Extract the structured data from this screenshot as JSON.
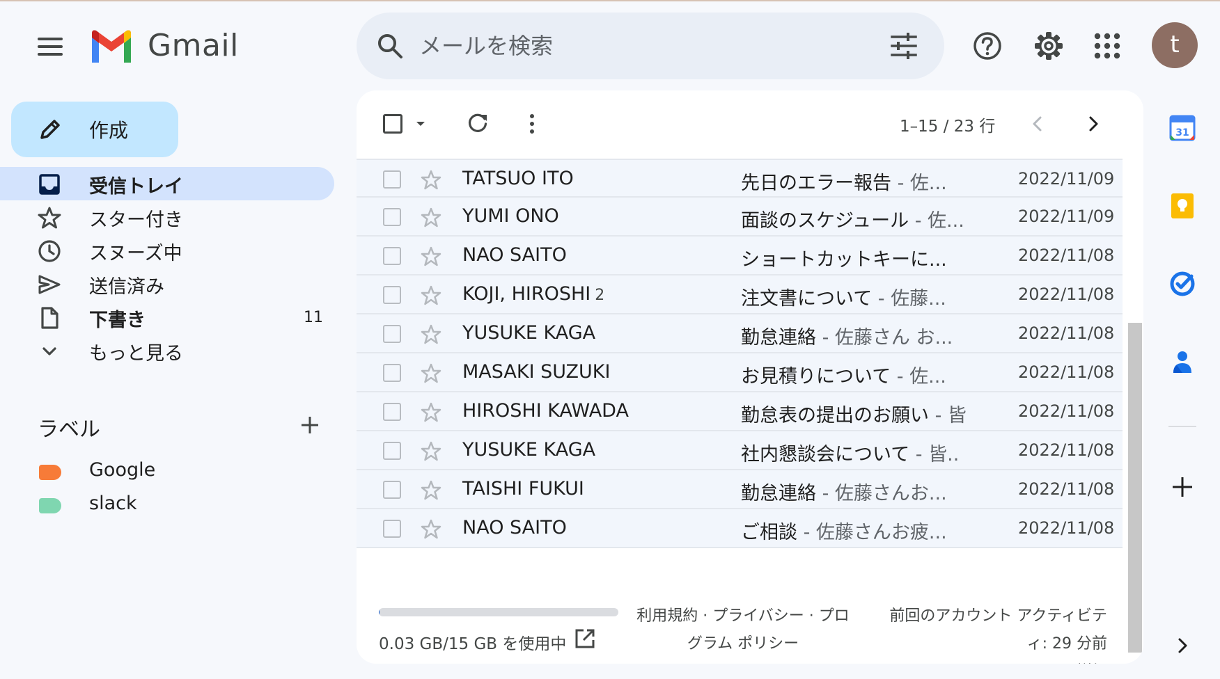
{
  "app": {
    "name": "Gmail"
  },
  "search": {
    "placeholder": "メールを検索"
  },
  "user": {
    "initial": "t"
  },
  "compose": {
    "label": "作成"
  },
  "nav": [
    {
      "label": "受信トレイ",
      "icon": "inbox-icon",
      "active": true,
      "bold": true,
      "count": ""
    },
    {
      "label": "スター付き",
      "icon": "star-icon",
      "active": false,
      "bold": false,
      "count": ""
    },
    {
      "label": "スヌーズ中",
      "icon": "clock-icon",
      "active": false,
      "bold": false,
      "count": ""
    },
    {
      "label": "送信済み",
      "icon": "send-icon",
      "active": false,
      "bold": false,
      "count": ""
    },
    {
      "label": "下書き",
      "icon": "draft-icon",
      "active": false,
      "bold": true,
      "count": "11"
    },
    {
      "label": "もっと見る",
      "icon": "chevron-down-icon",
      "active": false,
      "bold": false,
      "count": ""
    }
  ],
  "labels": {
    "title": "ラベル",
    "items": [
      {
        "label": "Google",
        "color": "#f77b38"
      },
      {
        "label": "slack",
        "color": "#7fd6b0"
      }
    ]
  },
  "toolbar": {
    "pager": "1–15 / 23 行"
  },
  "emails": [
    {
      "sender": "TATSUO ITO",
      "count": "",
      "subject": "先日のエラー報告",
      "snippet": " - 佐...",
      "date": "2022/11/09"
    },
    {
      "sender": "YUMI ONO",
      "count": "",
      "subject": "面談のスケジュール",
      "snippet": " - 佐...",
      "date": "2022/11/09"
    },
    {
      "sender": "NAO SAITO",
      "count": "",
      "subject": "ショートカットキーに...",
      "snippet": "",
      "date": "2022/11/08"
    },
    {
      "sender": "KOJI, HIROSHI",
      "count": "2",
      "subject": "注文書について",
      "snippet": " - 佐藤...",
      "date": "2022/11/08"
    },
    {
      "sender": "YUSUKE KAGA",
      "count": "",
      "subject": "勤怠連絡",
      "snippet": " - 佐藤さん お...",
      "date": "2022/11/08"
    },
    {
      "sender": "MASAKI SUZUKI",
      "count": "",
      "subject": "お見積りについて",
      "snippet": " - 佐...",
      "date": "2022/11/08"
    },
    {
      "sender": "HIROSHI KAWADA",
      "count": "",
      "subject": "勤怠表の提出のお願い",
      "snippet": " - 皆",
      "date": "2022/11/08"
    },
    {
      "sender": "YUSUKE KAGA",
      "count": "",
      "subject": "社内懇談会について",
      "snippet": " - 皆..",
      "date": "2022/11/08"
    },
    {
      "sender": "TAISHI FUKUI",
      "count": "",
      "subject": "勤怠連絡",
      "snippet": " - 佐藤さんお...",
      "date": "2022/11/08"
    },
    {
      "sender": "NAO SAITO",
      "count": "",
      "subject": "ご相談",
      "snippet": " - 佐藤さんお疲...",
      "date": "2022/11/08"
    }
  ],
  "footer": {
    "storage_text": "0.03 GB/15 GB を使用中",
    "storage_used_fraction": 0.002,
    "terms_line1": "利用規約 · プライバシー · プロ",
    "terms_line2": "グラム ポリシー",
    "activity_line1": "前回のアカウント アクティビテ",
    "activity_line2": "ィ: 29 分前",
    "details": "詳細"
  },
  "colors": {
    "compose_bg": "#c2e7ff",
    "active_nav_bg": "#d3e3fd",
    "avatar_bg": "#8d6e63"
  }
}
